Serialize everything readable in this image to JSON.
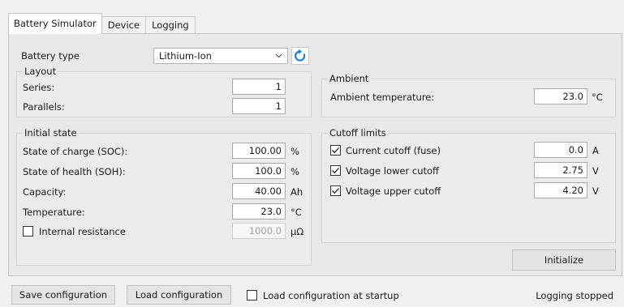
{
  "tabs": [
    "Battery Simulator",
    "Device",
    "Logging"
  ],
  "battery": {
    "label": "Battery type",
    "selected": "Lithium-Ion",
    "chevron_icon": "chevron-down-icon",
    "refresh_icon": "refresh-icon"
  },
  "layout_group": {
    "title": "Layout",
    "series_label": "Series:",
    "series_value": "1",
    "parallels_label": "Parallels:",
    "parallels_value": "1"
  },
  "ambient_group": {
    "title": "Ambient",
    "temp_label": "Ambient temperature:",
    "temp_value": "23.0",
    "temp_unit": "°C"
  },
  "initial_group": {
    "title": "Initial state",
    "soc_label": "State of charge (SOC):",
    "soc_value": "100.00",
    "soc_unit": "%",
    "soh_label": "State of health (SOH):",
    "soh_value": "100.0",
    "soh_unit": "%",
    "capacity_label": "Capacity:",
    "capacity_value": "40.00",
    "capacity_unit": "Ah",
    "temp_label": "Temperature:",
    "temp_value": "23.0",
    "temp_unit": "°C",
    "ir_label": "Internal resistance",
    "ir_checked": false,
    "ir_value": "1000.0",
    "ir_unit": "μΩ"
  },
  "cutoff_group": {
    "title": "Cutoff limits",
    "current_label": "Current cutoff (fuse)",
    "current_checked": true,
    "current_value": "0.0",
    "current_unit": "A",
    "vlow_label": "Voltage lower cutoff",
    "vlow_checked": true,
    "vlow_value": "2.75",
    "vlow_unit": "V",
    "vup_label": "Voltage upper cutoff",
    "vup_checked": true,
    "vup_value": "4.20",
    "vup_unit": "V"
  },
  "initialize_label": "Initialize",
  "footer": {
    "save_label": "Save configuration",
    "load_label": "Load configuration",
    "startup_label": "Load configuration at startup",
    "startup_checked": false,
    "status": "Logging stopped"
  },
  "colors": {
    "refresh_blue": "#1e7fd6"
  }
}
